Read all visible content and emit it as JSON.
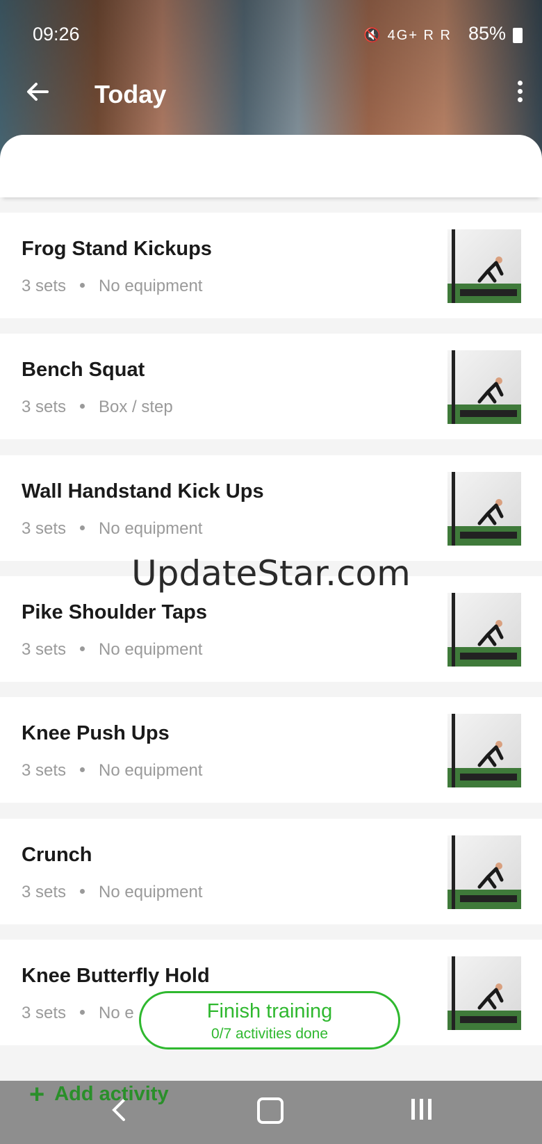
{
  "status_bar": {
    "time": "09:26",
    "indicators": "4G+ R R",
    "battery": "85%"
  },
  "header": {
    "title": "Today"
  },
  "activities": [
    {
      "name": "Frog Stand Kickups",
      "sets": "3 sets",
      "equipment": "No equipment"
    },
    {
      "name": "Bench Squat",
      "sets": "3 sets",
      "equipment": "Box / step"
    },
    {
      "name": "Wall Handstand Kick Ups",
      "sets": "3 sets",
      "equipment": "No equipment"
    },
    {
      "name": "Pike Shoulder Taps",
      "sets": "3 sets",
      "equipment": "No equipment"
    },
    {
      "name": "Knee Push Ups",
      "sets": "3 sets",
      "equipment": "No equipment"
    },
    {
      "name": "Crunch",
      "sets": "3 sets",
      "equipment": "No equipment"
    },
    {
      "name": "Knee Butterfly Hold",
      "sets": "3 sets",
      "equipment": "No e"
    }
  ],
  "watermark": "UpdateStar.com",
  "finish": {
    "title": "Finish training",
    "subtitle": "0/7 activities done"
  },
  "add_activity": {
    "label": "Add activity"
  },
  "colors": {
    "accent": "#2fb82f",
    "nav_bar": "#8e8e8e"
  }
}
